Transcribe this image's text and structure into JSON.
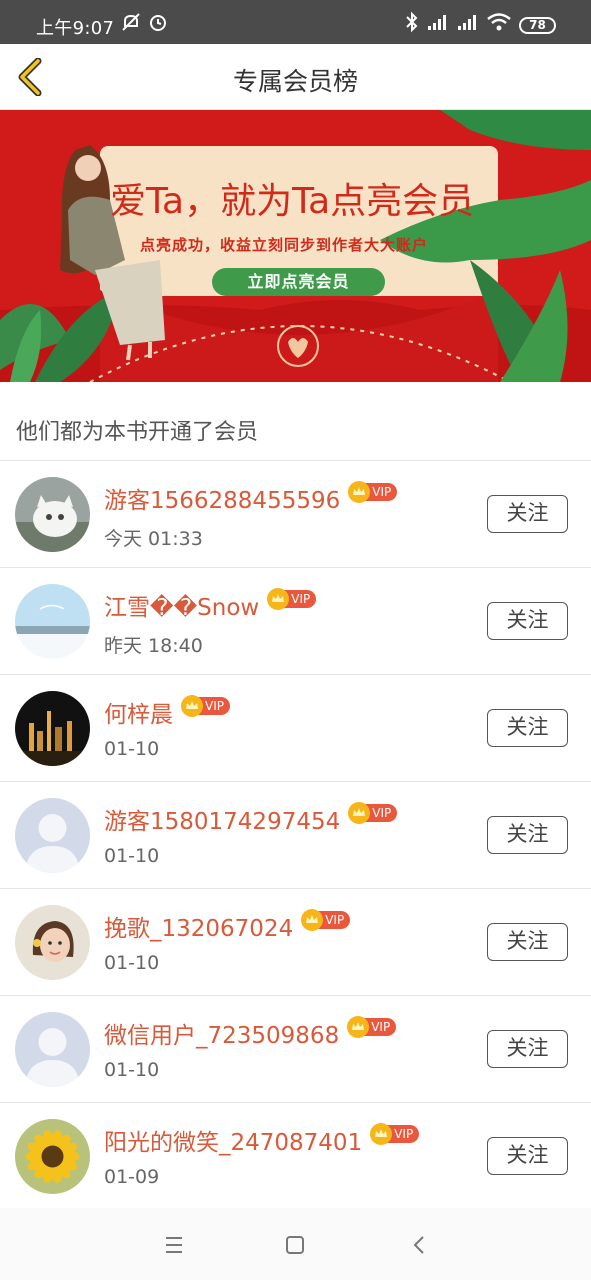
{
  "status_bar": {
    "time": "上午9:07",
    "battery": "78"
  },
  "header": {
    "title": "专属会员榜"
  },
  "banner": {
    "headline": "爱Ta，就为Ta点亮会员",
    "subline": "点亮成功，收益立刻同步到作者大大账户",
    "cta": "立即点亮会员"
  },
  "section_title": "他们都为本书开通了会员",
  "vip_label": "VIP",
  "follow_label": "关注",
  "members": [
    {
      "name": "游客1566288455596",
      "time": "今天 01:33",
      "avatar": "cat-photo-avatar"
    },
    {
      "name": "江雪��Snow",
      "time": "昨天 18:40",
      "avatar": "snow-landscape-avatar"
    },
    {
      "name": "何梓晨",
      "time": "01-10",
      "avatar": "city-night-avatar"
    },
    {
      "name": "游客1580174297454",
      "time": "01-10",
      "avatar": "default-person-avatar"
    },
    {
      "name": "挽歌_132067024",
      "time": "01-10",
      "avatar": "girl-photo-avatar"
    },
    {
      "name": "微信用户_723509868",
      "time": "01-10",
      "avatar": "default-person-avatar"
    },
    {
      "name": "阳光的微笑_247087401",
      "time": "01-09",
      "avatar": "sunflower-avatar"
    }
  ],
  "colors": {
    "accent": "#d85a3a",
    "banner_red": "#d11a1a",
    "vip_red": "#e9573d",
    "crown_gold": "#f6b519",
    "cta_green": "#3f9a4a"
  }
}
